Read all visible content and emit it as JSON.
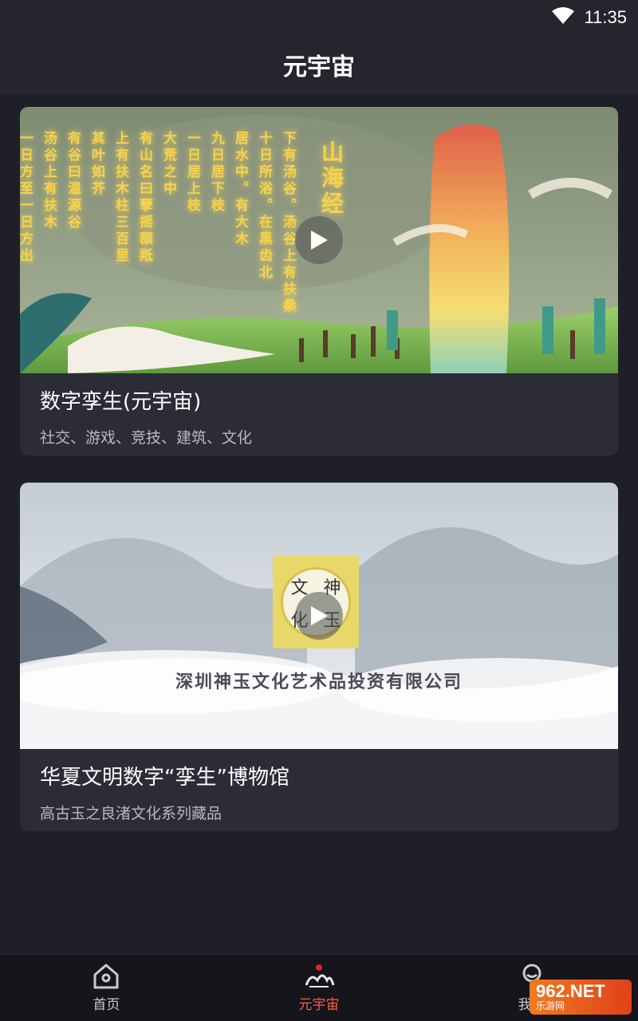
{
  "status_bar": {
    "time": "11:35",
    "wifi_icon": "wifi-icon"
  },
  "app_bar": {
    "title": "元宇宙"
  },
  "cards": [
    {
      "title": "数字孪生(元宇宙)",
      "subtitle": "社交、游戏、竞技、建筑、文化",
      "overlay_title": "山海经",
      "overlay_columns": [
        "下有汤谷。汤谷上有扶桑",
        "十日所浴。在黑齿北",
        "居水中。有大木",
        "九日居下枝",
        "一日居上枝",
        "大荒之中",
        "有山名曰孽摇頵羝",
        "上有扶木柱三百里",
        "其叶如芥",
        "有谷曰温源谷",
        "汤谷上有扶木",
        "一日方至一日方出"
      ]
    },
    {
      "title": "华夏文明数字“孪生”博物馆",
      "subtitle": "高古玉之良渚文化系列藏品",
      "company": "深圳神玉文化艺术品投资有限公司",
      "logo_chars": [
        "文",
        "神",
        "化",
        "玉"
      ]
    }
  ],
  "bottom_nav": {
    "items": [
      {
        "label": "首页",
        "icon": "home-icon",
        "active": false
      },
      {
        "label": "元宇宙",
        "icon": "metaverse-logo-icon",
        "active": true
      },
      {
        "label": "我的",
        "icon": "profile-icon",
        "active": false
      }
    ],
    "active_color": "#ff5a3c"
  },
  "watermark": {
    "main": "962.NET",
    "sub": "乐游网"
  }
}
